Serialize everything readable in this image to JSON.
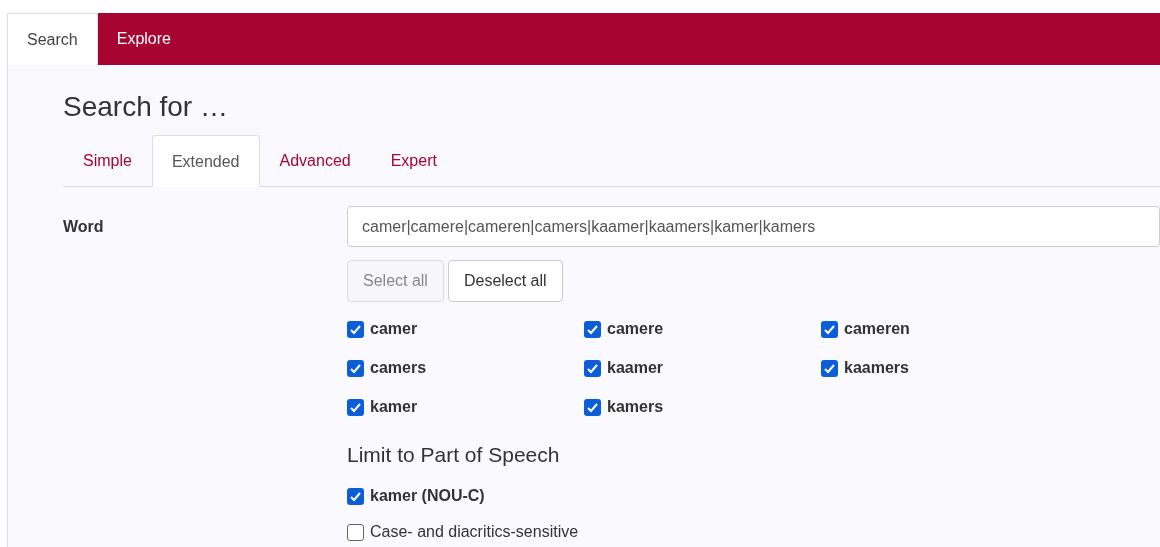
{
  "nav_tabs": [
    {
      "label": "Search",
      "selected": true
    },
    {
      "label": "Explore",
      "selected": false
    }
  ],
  "heading": "Search for …",
  "search_tabs": [
    {
      "label": "Simple",
      "selected": false
    },
    {
      "label": "Extended",
      "selected": true
    },
    {
      "label": "Advanced",
      "selected": false
    },
    {
      "label": "Expert",
      "selected": false
    }
  ],
  "word_field": {
    "label": "Word",
    "value": "camer|camere|cameren|camers|kaamer|kaamers|kamer|kamers"
  },
  "buttons": [
    {
      "label": "Select all",
      "disabled": true
    },
    {
      "label": "Deselect all",
      "disabled": false
    }
  ],
  "word_options": [
    {
      "label": "camer",
      "checked": true
    },
    {
      "label": "camere",
      "checked": true
    },
    {
      "label": "cameren",
      "checked": true
    },
    {
      "label": "camers",
      "checked": true
    },
    {
      "label": "kaamer",
      "checked": true
    },
    {
      "label": "kaamers",
      "checked": true
    },
    {
      "label": "kamer",
      "checked": true
    },
    {
      "label": "kamers",
      "checked": true
    }
  ],
  "pos_heading": "Limit to Part of Speech",
  "pos_options": [
    {
      "label": "kamer (NOU-C)",
      "checked": true
    }
  ],
  "case_sensitive": {
    "label": "Case- and diacritics-sensitive",
    "checked": false
  }
}
